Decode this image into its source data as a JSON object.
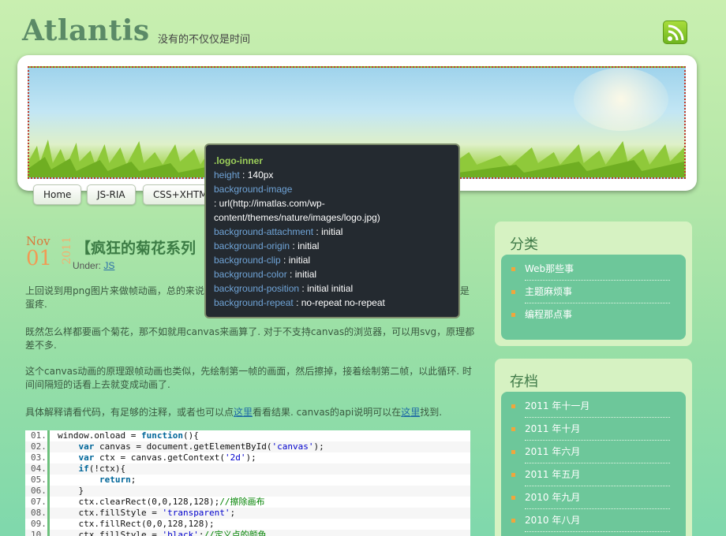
{
  "site": {
    "title": "Atlantis",
    "tagline": "没有的不仅仅是时间"
  },
  "nav": {
    "items": [
      "Home",
      "JS-RIA",
      "CSS+XHTML"
    ]
  },
  "post": {
    "date_month": "Nov",
    "date_day": "01",
    "date_year": "2011",
    "title": "【疯狂的菊花系列",
    "under_label": "Under:",
    "category": "JS",
    "p1": "上回说到用png图片来做帧动画，总的来说也",
    "p1_tail": "是蛋疼.",
    "p2": "既然怎么样都要画个菊花，那不如就用canvas来画算了. 对于不支持canvas的浏览器，可以用svg，原理都差不多.",
    "p3": "这个canvas动画的原理跟帧动画也类似，先绘制第一帧的画面，然后擦掉，接着绘制第二帧，以此循环. 时间间隔短的话看上去就变成动画了.",
    "p4_a": "具体解释请看代码，有足够的注释，或者也可以点",
    "p4_link1": "这里",
    "p4_b": "看看结果. canvas的api说明可以在",
    "p4_link2": "这里",
    "p4_c": "找到."
  },
  "code": {
    "lines": [
      {
        "n": "01.",
        "html": "window.onload = <span class='kw'>function</span>(){"
      },
      {
        "n": "02.",
        "html": "    <span class='kw'>var</span> canvas = document.getElementById(<span class='str'>'canvas'</span>);"
      },
      {
        "n": "03.",
        "html": "    <span class='kw'>var</span> ctx = canvas.getContext(<span class='str'>'2d'</span>);"
      },
      {
        "n": "04.",
        "html": "    <span class='kw'>if</span>(!ctx){"
      },
      {
        "n": "05.",
        "html": "        <span class='kw'>return</span>;"
      },
      {
        "n": "06.",
        "html": "    }"
      },
      {
        "n": "07.",
        "html": "    ctx.clearRect(0,0,128,128);<span class='cm'>//擦除画布</span>"
      },
      {
        "n": "08.",
        "html": "    ctx.fillStyle = <span class='str'>'transparent'</span>;"
      },
      {
        "n": "09.",
        "html": "    ctx.fillRect(0,0,128,128);"
      },
      {
        "n": "10.",
        "html": "    ctx.fillStyle = <span class='str'>'black'</span>;<span class='cm'>//定义点的颜色</span>"
      }
    ]
  },
  "sidebar": {
    "categories_title": "分类",
    "categories": [
      "Web那些事",
      "主题麻烦事",
      "编程那点事"
    ],
    "archives_title": "存档",
    "archives": [
      "2011 年十一月",
      "2011 年十月",
      "2011 年六月",
      "2011 年五月",
      "2010 年九月",
      "2010 年八月"
    ]
  },
  "tooltip": {
    "selector": ".logo-inner",
    "rows": [
      {
        "prop": "height",
        "val": "140px"
      },
      {
        "prop": "background-image",
        "val": ""
      },
      {
        "prop": "",
        "val": "url(http://imatlas.com/wp-"
      },
      {
        "prop": "",
        "val": "content/themes/nature/images/logo.jpg)"
      },
      {
        "prop": "background-attachment",
        "val": "initial"
      },
      {
        "prop": "background-origin",
        "val": "initial"
      },
      {
        "prop": "background-clip",
        "val": "initial"
      },
      {
        "prop": "background-color",
        "val": "initial"
      },
      {
        "prop": "background-position",
        "val": "initial initial"
      },
      {
        "prop": "background-repeat",
        "val": "no-repeat no-repeat"
      }
    ]
  },
  "colors": {
    "accent_green": "#3c7c45",
    "tooltip_bg": "#242a30",
    "sidebar_inner": "#6dc79a",
    "date_orange": "#f29a53"
  }
}
